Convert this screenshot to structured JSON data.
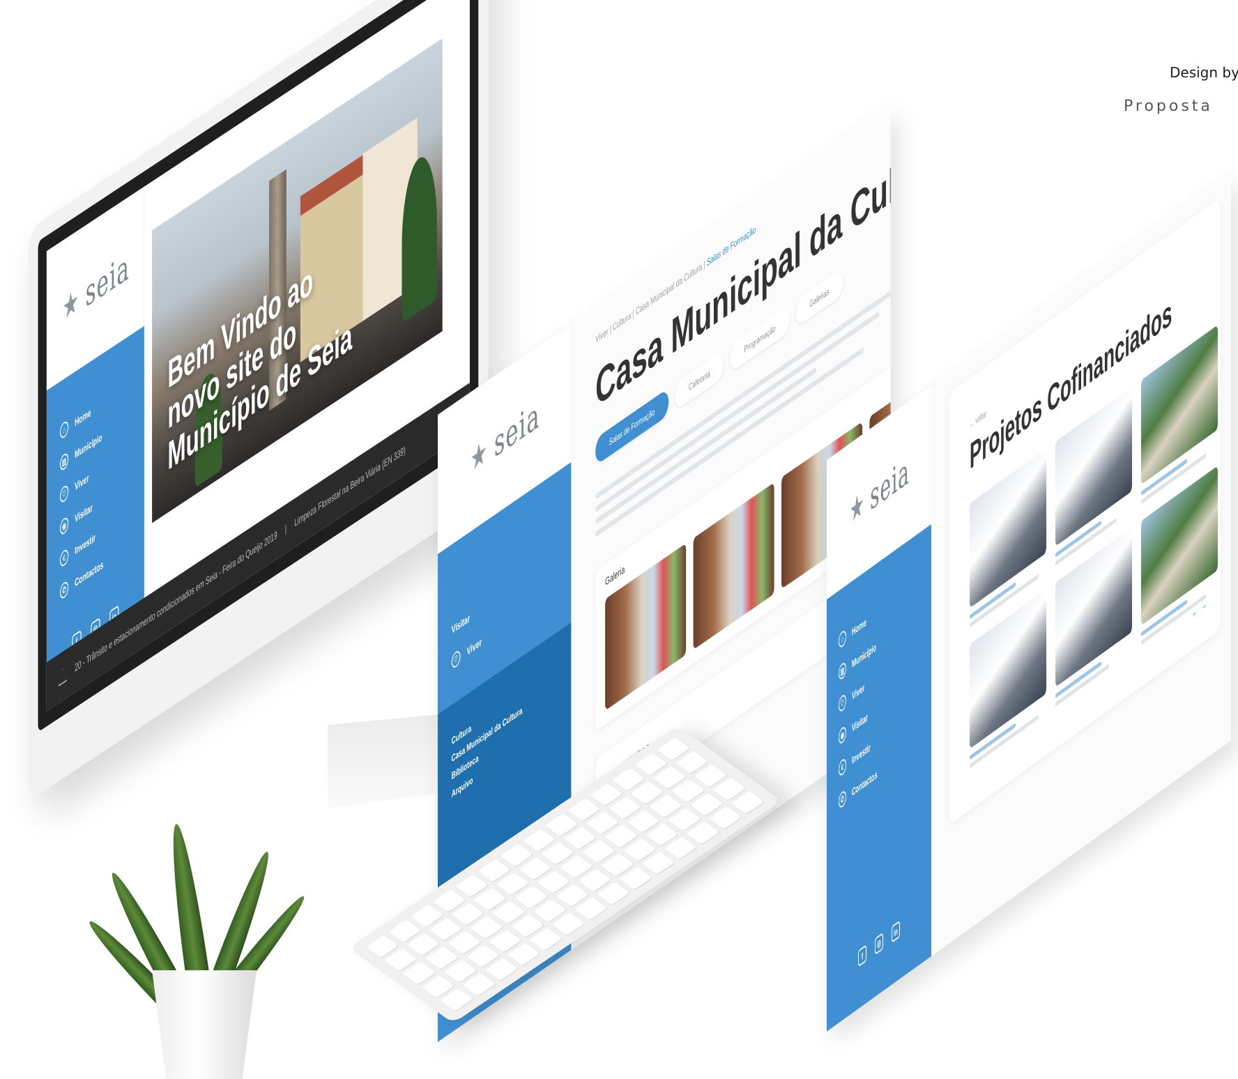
{
  "credit": {
    "design_by": "Design by",
    "subtitle": "Proposta"
  },
  "brand": {
    "logo_text": "seia"
  },
  "sidebar": {
    "items": [
      {
        "label": "Home",
        "icon": "home-icon"
      },
      {
        "label": "Município",
        "icon": "building-icon"
      },
      {
        "label": "Viver",
        "icon": "heart-icon"
      },
      {
        "label": "Visitar",
        "icon": "eye-icon"
      },
      {
        "label": "Investir",
        "icon": "investment-icon"
      },
      {
        "label": "Contactos",
        "icon": "phone-icon"
      }
    ],
    "social": [
      {
        "label": "f",
        "icon": "facebook-icon"
      },
      {
        "label": "◎",
        "icon": "instagram-icon"
      },
      {
        "label": "in",
        "icon": "linkedin-icon"
      }
    ]
  },
  "home_page": {
    "hero_title": "Bem Vindo ao novo site do Município de Seia",
    "ticker": [
      "20 - Trânsito e estacionamento condicionados em Seia - Feira do Queijo 2019",
      "Limpeza Florestal na Beira Viária (EN 339)"
    ]
  },
  "cultura_page": {
    "breadcrumb": [
      "Viver",
      "Cultura",
      "Casa Municipal da Cultura",
      "Salas de Formação"
    ],
    "title": "Casa Municipal da Cultura",
    "tabs": [
      "Salas de Formação",
      "Cafetaria",
      "Programação",
      "Galerias"
    ],
    "sidebar_items": [
      "Visitar",
      "Viver"
    ],
    "submenu": [
      "Cultura",
      "Casa Municipal da Cultura",
      "Biblioteca",
      "Arquivo"
    ],
    "gallery_label": "Galeria",
    "documents_label": "DOCUMENTOS"
  },
  "projetos_page": {
    "back_label": "← voltar",
    "title": "Projetos Cofinanciados",
    "pager": [
      "←",
      "→"
    ]
  },
  "colors": {
    "accent": "#3f8fd2",
    "accent_dark": "#1f6fae",
    "text": "#333333"
  }
}
